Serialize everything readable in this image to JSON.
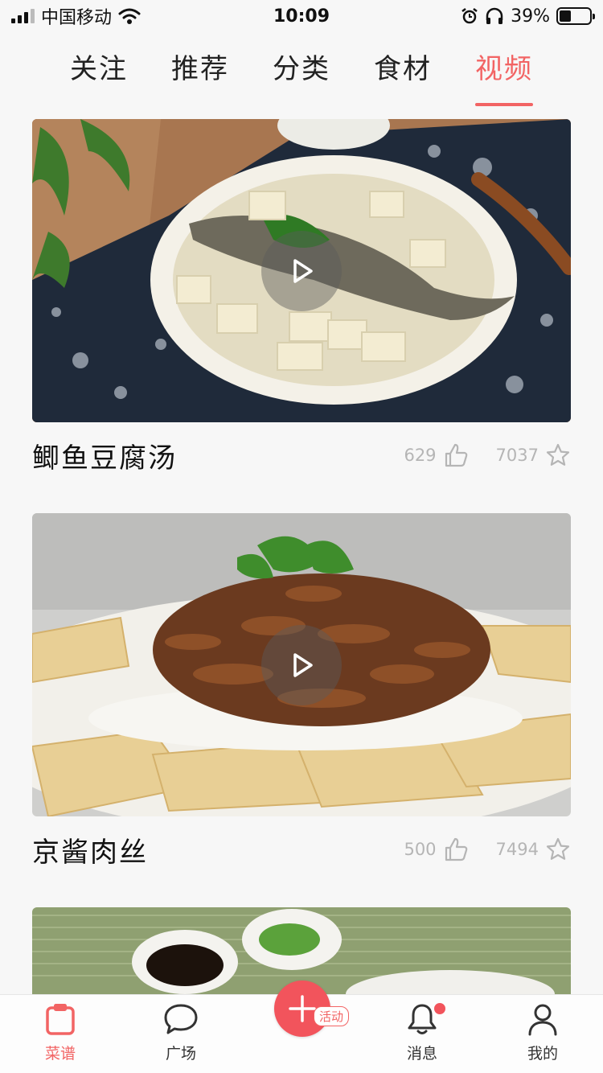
{
  "status_bar": {
    "carrier": "中国移动",
    "time": "10:09",
    "battery": "39%",
    "battery_level": 0.39
  },
  "tabs": [
    {
      "label": "关注",
      "active": false
    },
    {
      "label": "推荐",
      "active": false
    },
    {
      "label": "分类",
      "active": false
    },
    {
      "label": "食材",
      "active": false
    },
    {
      "label": "视频",
      "active": true
    }
  ],
  "feed": [
    {
      "title": "鲫鱼豆腐汤",
      "likes": "629",
      "favorites": "7037"
    },
    {
      "title": "京酱肉丝",
      "likes": "500",
      "favorites": "7494"
    },
    {
      "title": ""
    }
  ],
  "tabbar": {
    "items": [
      {
        "label": "菜谱",
        "icon": "clipboard-icon",
        "active": true
      },
      {
        "label": "广场",
        "icon": "speech-bubble-icon",
        "active": false
      },
      {
        "label": "",
        "icon": "plus-icon",
        "badge": "活动"
      },
      {
        "label": "消息",
        "icon": "bell-icon",
        "active": false
      },
      {
        "label": "我的",
        "icon": "person-icon",
        "active": false
      }
    ]
  },
  "colors": {
    "accent": "#f26464",
    "text": "#111111",
    "muted": "#b5b5b5"
  }
}
